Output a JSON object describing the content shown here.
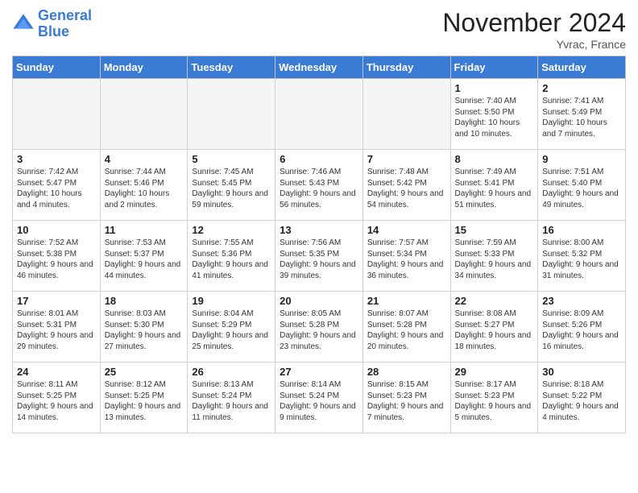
{
  "header": {
    "logo_line1": "General",
    "logo_line2": "Blue",
    "month": "November 2024",
    "location": "Yvrac, France"
  },
  "weekdays": [
    "Sunday",
    "Monday",
    "Tuesday",
    "Wednesday",
    "Thursday",
    "Friday",
    "Saturday"
  ],
  "weeks": [
    [
      {
        "day": "",
        "detail": ""
      },
      {
        "day": "",
        "detail": ""
      },
      {
        "day": "",
        "detail": ""
      },
      {
        "day": "",
        "detail": ""
      },
      {
        "day": "",
        "detail": ""
      },
      {
        "day": "1",
        "detail": "Sunrise: 7:40 AM\nSunset: 5:50 PM\nDaylight: 10 hours\nand 10 minutes."
      },
      {
        "day": "2",
        "detail": "Sunrise: 7:41 AM\nSunset: 5:49 PM\nDaylight: 10 hours\nand 7 minutes."
      }
    ],
    [
      {
        "day": "3",
        "detail": "Sunrise: 7:42 AM\nSunset: 5:47 PM\nDaylight: 10 hours\nand 4 minutes."
      },
      {
        "day": "4",
        "detail": "Sunrise: 7:44 AM\nSunset: 5:46 PM\nDaylight: 10 hours\nand 2 minutes."
      },
      {
        "day": "5",
        "detail": "Sunrise: 7:45 AM\nSunset: 5:45 PM\nDaylight: 9 hours\nand 59 minutes."
      },
      {
        "day": "6",
        "detail": "Sunrise: 7:46 AM\nSunset: 5:43 PM\nDaylight: 9 hours\nand 56 minutes."
      },
      {
        "day": "7",
        "detail": "Sunrise: 7:48 AM\nSunset: 5:42 PM\nDaylight: 9 hours\nand 54 minutes."
      },
      {
        "day": "8",
        "detail": "Sunrise: 7:49 AM\nSunset: 5:41 PM\nDaylight: 9 hours\nand 51 minutes."
      },
      {
        "day": "9",
        "detail": "Sunrise: 7:51 AM\nSunset: 5:40 PM\nDaylight: 9 hours\nand 49 minutes."
      }
    ],
    [
      {
        "day": "10",
        "detail": "Sunrise: 7:52 AM\nSunset: 5:38 PM\nDaylight: 9 hours\nand 46 minutes."
      },
      {
        "day": "11",
        "detail": "Sunrise: 7:53 AM\nSunset: 5:37 PM\nDaylight: 9 hours\nand 44 minutes."
      },
      {
        "day": "12",
        "detail": "Sunrise: 7:55 AM\nSunset: 5:36 PM\nDaylight: 9 hours\nand 41 minutes."
      },
      {
        "day": "13",
        "detail": "Sunrise: 7:56 AM\nSunset: 5:35 PM\nDaylight: 9 hours\nand 39 minutes."
      },
      {
        "day": "14",
        "detail": "Sunrise: 7:57 AM\nSunset: 5:34 PM\nDaylight: 9 hours\nand 36 minutes."
      },
      {
        "day": "15",
        "detail": "Sunrise: 7:59 AM\nSunset: 5:33 PM\nDaylight: 9 hours\nand 34 minutes."
      },
      {
        "day": "16",
        "detail": "Sunrise: 8:00 AM\nSunset: 5:32 PM\nDaylight: 9 hours\nand 31 minutes."
      }
    ],
    [
      {
        "day": "17",
        "detail": "Sunrise: 8:01 AM\nSunset: 5:31 PM\nDaylight: 9 hours\nand 29 minutes."
      },
      {
        "day": "18",
        "detail": "Sunrise: 8:03 AM\nSunset: 5:30 PM\nDaylight: 9 hours\nand 27 minutes."
      },
      {
        "day": "19",
        "detail": "Sunrise: 8:04 AM\nSunset: 5:29 PM\nDaylight: 9 hours\nand 25 minutes."
      },
      {
        "day": "20",
        "detail": "Sunrise: 8:05 AM\nSunset: 5:28 PM\nDaylight: 9 hours\nand 23 minutes."
      },
      {
        "day": "21",
        "detail": "Sunrise: 8:07 AM\nSunset: 5:28 PM\nDaylight: 9 hours\nand 20 minutes."
      },
      {
        "day": "22",
        "detail": "Sunrise: 8:08 AM\nSunset: 5:27 PM\nDaylight: 9 hours\nand 18 minutes."
      },
      {
        "day": "23",
        "detail": "Sunrise: 8:09 AM\nSunset: 5:26 PM\nDaylight: 9 hours\nand 16 minutes."
      }
    ],
    [
      {
        "day": "24",
        "detail": "Sunrise: 8:11 AM\nSunset: 5:25 PM\nDaylight: 9 hours\nand 14 minutes."
      },
      {
        "day": "25",
        "detail": "Sunrise: 8:12 AM\nSunset: 5:25 PM\nDaylight: 9 hours\nand 13 minutes."
      },
      {
        "day": "26",
        "detail": "Sunrise: 8:13 AM\nSunset: 5:24 PM\nDaylight: 9 hours\nand 11 minutes."
      },
      {
        "day": "27",
        "detail": "Sunrise: 8:14 AM\nSunset: 5:24 PM\nDaylight: 9 hours\nand 9 minutes."
      },
      {
        "day": "28",
        "detail": "Sunrise: 8:15 AM\nSunset: 5:23 PM\nDaylight: 9 hours\nand 7 minutes."
      },
      {
        "day": "29",
        "detail": "Sunrise: 8:17 AM\nSunset: 5:23 PM\nDaylight: 9 hours\nand 5 minutes."
      },
      {
        "day": "30",
        "detail": "Sunrise: 8:18 AM\nSunset: 5:22 PM\nDaylight: 9 hours\nand 4 minutes."
      }
    ]
  ]
}
